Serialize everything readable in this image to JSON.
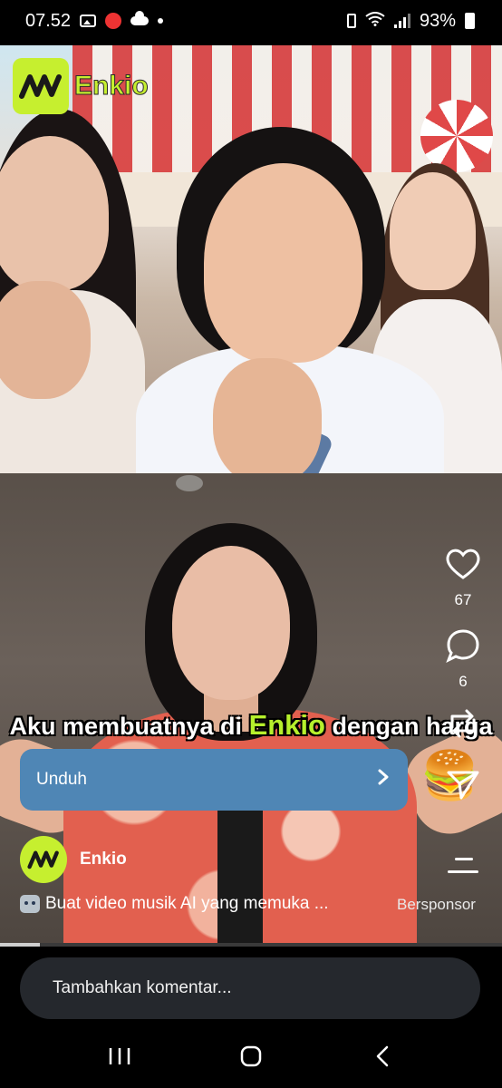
{
  "status_bar": {
    "time": "07.52",
    "battery": "93%"
  },
  "top_video": {
    "brand": "Enkio"
  },
  "ad": {
    "caption_before": "Aku membuatnya di",
    "caption_highlight": "Enkio",
    "caption_after": "dengan harga",
    "download_label": "Unduh",
    "advertiser": "Enkio",
    "description": "Buat video musik AI yang memuka ...",
    "sponsored_label": "Bersponsor",
    "progress": 0.08
  },
  "actions": {
    "likes": "67",
    "comments": "6"
  },
  "icons": {
    "like": "heart-icon",
    "comment": "comment-bubble-icon",
    "share": "share-icon",
    "send": "send-icon",
    "menu": "menu-icon",
    "download_chevron": "chevron-right-icon"
  },
  "comment": {
    "placeholder": "Tambahkan komentar..."
  },
  "colors": {
    "brand_green": "#c6ef2f",
    "download_button": "#4f86b5",
    "comment_bg": "#25282d"
  }
}
